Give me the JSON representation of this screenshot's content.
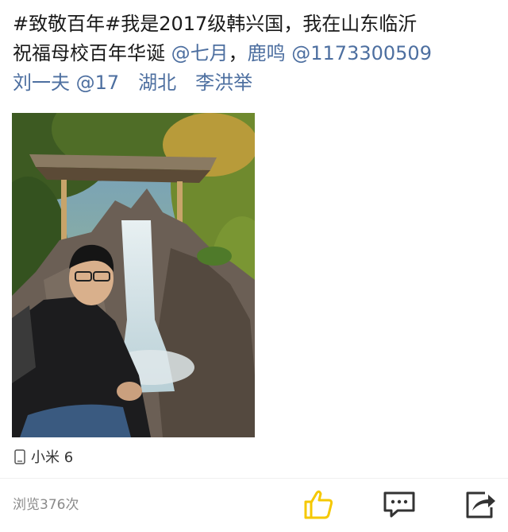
{
  "post": {
    "line1": "#致敬百年#我是2017级韩兴国，我在山东临沂",
    "line2_plain": "祝福母校百年华诞 ",
    "line2_mention1": "@七月",
    "line2_sep": "，",
    "line2_mention2": "鹿鸣 @1173300509",
    "line3_mention": "刘一夫 @17　湖北　李洪举"
  },
  "device": {
    "icon": "phone-icon",
    "label": "小米 6"
  },
  "footer": {
    "views": "浏览376次",
    "actions": {
      "like_icon": "thumbs-up-icon",
      "comment_icon": "comment-icon",
      "share_icon": "share-icon"
    }
  },
  "colors": {
    "text": "#1a1a1a",
    "mention": "#4d6fa0",
    "muted": "#8a8a8a",
    "like": "#f5c800",
    "icon": "#333333"
  }
}
